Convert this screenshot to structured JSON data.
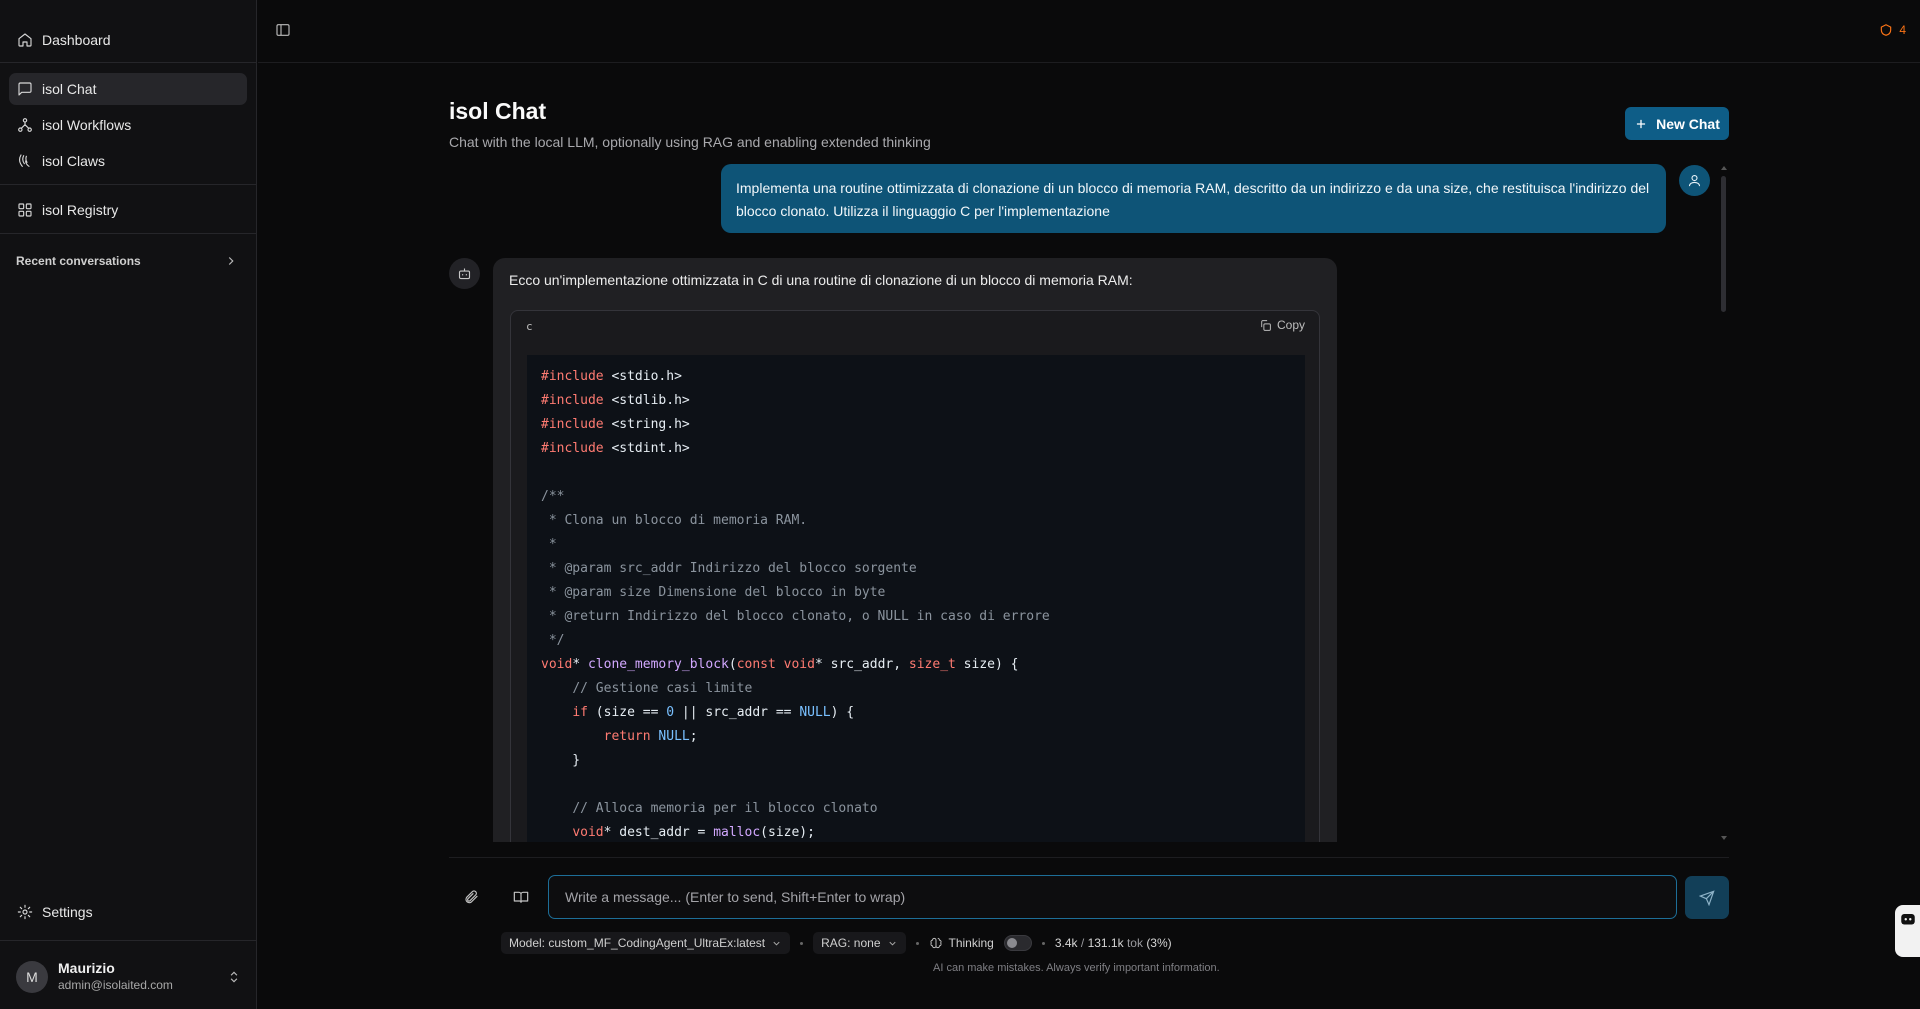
{
  "sidebar": {
    "nav": [
      {
        "label": "Dashboard",
        "icon": "home-icon"
      },
      {
        "label": "isol Chat",
        "icon": "message-square-icon",
        "active": true
      },
      {
        "label": "isol Workflows",
        "icon": "workflow-icon"
      },
      {
        "label": "isol Claws",
        "icon": "claws-icon"
      },
      {
        "label": "isol Registry",
        "icon": "grid-icon"
      }
    ],
    "recent_label": "Recent conversations",
    "settings_label": "Settings",
    "user": {
      "initial": "M",
      "name": "Maurizio",
      "email": "admin@isolaited.com"
    }
  },
  "topbar": {
    "alert_count": "4",
    "alert_color": "#f97316"
  },
  "header": {
    "title": "isol Chat",
    "subtitle": "Chat with the local LLM, optionally using RAG and enabling extended thinking",
    "new_chat_label": "New Chat"
  },
  "messages": {
    "user_text": "Implementa una routine ottimizzata di clonazione di un blocco di memoria RAM, descritto da un indirizzo e da una size, che restituisca l'indirizzo del blocco clonato. Utilizza il linguaggio C per l'implementazione",
    "assistant_intro": "Ecco un'implementazione ottimizzata in C di una routine di clonazione di un blocco di memoria RAM:",
    "code_lang": "c",
    "copy_label": "Copy"
  },
  "composer": {
    "placeholder": "Write a message... (Enter to send, Shift+Enter to wrap)",
    "model_label": "Model: custom_MF_CodingAgent_UltraEx:latest",
    "rag_label": "RAG: none",
    "thinking_label": "Thinking",
    "tokens_used": "3.4k",
    "tokens_sep": "/",
    "tokens_total": "131.1k",
    "tokens_unit": "tok",
    "tokens_pct": "(3%)",
    "disclaimer": "AI can make mistakes. Always verify important information."
  },
  "colors": {
    "accent": "#0e5d87",
    "user_bubble": "#0e5477",
    "focus_border": "#1d6e98"
  }
}
